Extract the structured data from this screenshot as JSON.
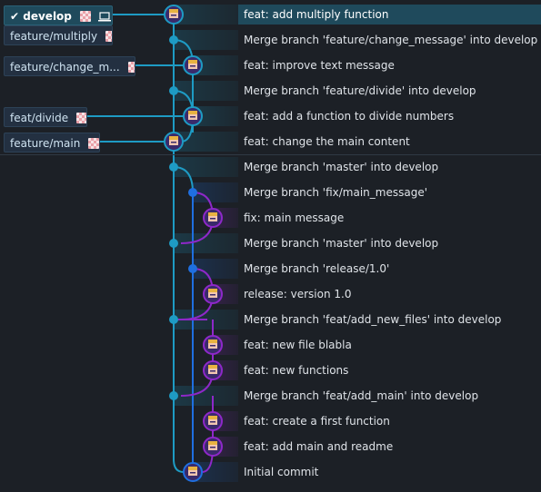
{
  "branches": {
    "develop": "develop",
    "feature_multiply": "feature/multiply",
    "feature_change_message": "feature/change_m...",
    "feat_divide": "feat/divide",
    "feature_main": "feature/main"
  },
  "colors": {
    "lane_main": "#1e9bc4",
    "lane_blue": "#1f6fe0",
    "lane_purple": "#8e28c9",
    "selected_row": "#1f4a5c"
  },
  "commits": [
    {
      "message": "feat: add multiply function"
    },
    {
      "message": "Merge branch 'feature/change_message' into develop"
    },
    {
      "message": "feat: improve text message"
    },
    {
      "message": "Merge branch 'feature/divide' into develop"
    },
    {
      "message": "feat: add a function to divide numbers"
    },
    {
      "message": "feat: change the main content"
    },
    {
      "message": "Merge branch 'master' into develop"
    },
    {
      "message": "Merge branch 'fix/main_message'"
    },
    {
      "message": "fix: main message"
    },
    {
      "message": "Merge branch 'master' into develop"
    },
    {
      "message": "Merge branch 'release/1.0'"
    },
    {
      "message": "release: version 1.0"
    },
    {
      "message": "Merge branch 'feat/add_new_files' into develop"
    },
    {
      "message": "feat: new file blabla"
    },
    {
      "message": "feat: new functions"
    },
    {
      "message": "Merge branch 'feat/add_main' into develop"
    },
    {
      "message": "feat: create a first function"
    },
    {
      "message": "feat: add main and readme"
    },
    {
      "message": "Initial commit"
    }
  ],
  "icons": {
    "checkmark": "checkmark-icon",
    "laptop": "laptop-icon",
    "remote": "remote-avatar-icon",
    "author": "author-avatar-icon"
  }
}
